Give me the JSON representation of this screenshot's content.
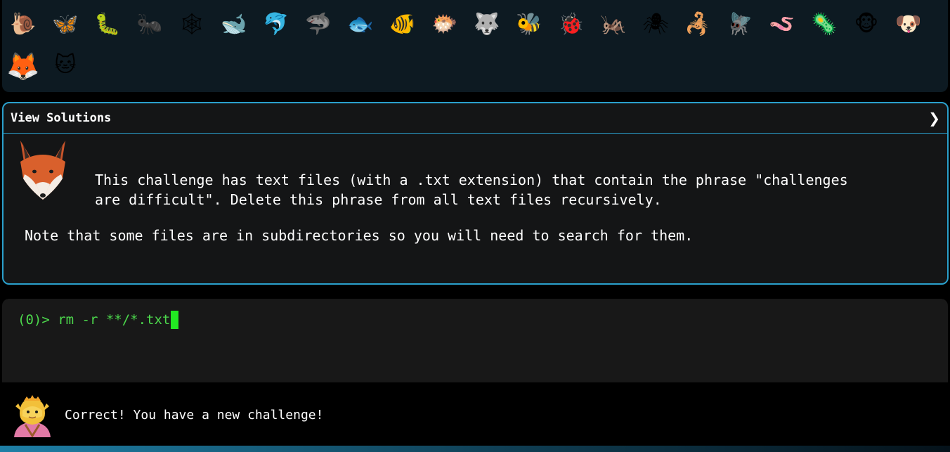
{
  "animals": [
    {
      "name": "snail",
      "glyph": "🐌",
      "state": "unlocked"
    },
    {
      "name": "butterfly",
      "glyph": "🦋",
      "state": "unlocked"
    },
    {
      "name": "caterpillar",
      "glyph": "🐛",
      "state": "unlocked"
    },
    {
      "name": "ant",
      "glyph": "🐜",
      "state": "locked"
    },
    {
      "name": "spider-web",
      "glyph": "🕸",
      "state": "locked"
    },
    {
      "name": "whale",
      "glyph": "🐋",
      "state": "unlocked"
    },
    {
      "name": "dolphin",
      "glyph": "🐬",
      "state": "unlocked"
    },
    {
      "name": "shark",
      "glyph": "🦈",
      "state": "locked"
    },
    {
      "name": "fish",
      "glyph": "🐟",
      "state": "unlocked"
    },
    {
      "name": "tropical-fish",
      "glyph": "🐠",
      "state": "unlocked"
    },
    {
      "name": "pufferfish",
      "glyph": "🐡",
      "state": "unlocked"
    },
    {
      "name": "wolf",
      "glyph": "🐺",
      "state": "unlocked"
    },
    {
      "name": "bee",
      "glyph": "🐝",
      "state": "unlocked"
    },
    {
      "name": "ladybug",
      "glyph": "🐞",
      "state": "unlocked"
    },
    {
      "name": "cricket",
      "glyph": "🦗",
      "state": "unlocked"
    },
    {
      "name": "spider",
      "glyph": "🕷",
      "state": "locked"
    },
    {
      "name": "scorpion",
      "glyph": "🦂",
      "state": "unlocked"
    },
    {
      "name": "fly",
      "glyph": "🪰",
      "state": "unlocked"
    },
    {
      "name": "worm",
      "glyph": "🪱",
      "state": "unlocked"
    },
    {
      "name": "microbe",
      "glyph": "🦠",
      "state": "unlocked"
    },
    {
      "name": "monkey",
      "glyph": "🐵",
      "state": "unlocked"
    },
    {
      "name": "dog",
      "glyph": "🐶",
      "state": "unlocked"
    },
    {
      "name": "fox",
      "glyph": "🦊",
      "state": "active"
    },
    {
      "name": "cat",
      "glyph": "🐱",
      "state": "unlocked"
    }
  ],
  "challenge": {
    "title": "View Solutions",
    "toggle_glyph": "❯",
    "text": "This challenge has text files (with a .txt extension) that contain the phrase \"challenges\nare difficult\". Delete this phrase from all text files recursively.",
    "note": "Note that some files are in subdirectories so you will need to search for them."
  },
  "terminal": {
    "prompt": "(0)>",
    "command": "rm -r **/*.txt"
  },
  "feedback": {
    "message": "Correct! You have a new challenge!"
  },
  "colors": {
    "accent": "#2aa0cc",
    "terminal_green": "#4cd84c",
    "background": "#000000"
  }
}
